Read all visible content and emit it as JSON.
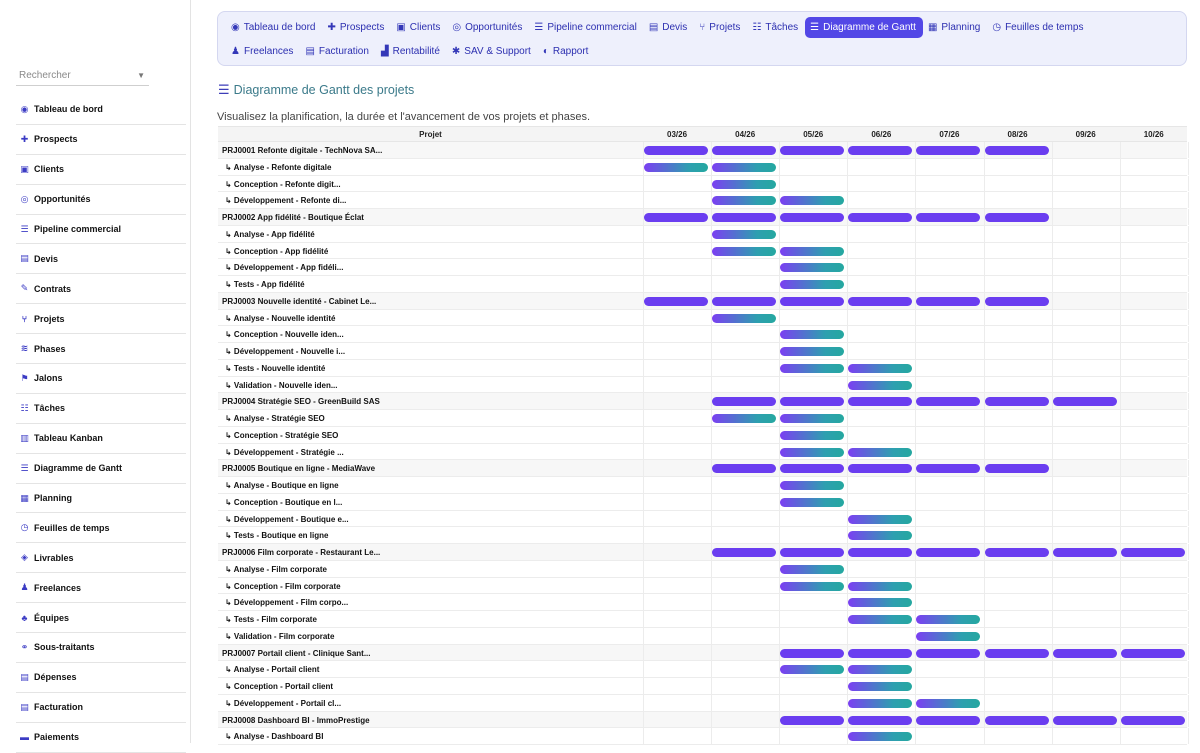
{
  "search": {
    "placeholder": "Rechercher"
  },
  "sidebar": {
    "items": [
      {
        "label": "Tableau de bord",
        "icon": "dashboard-icon",
        "glyph": "◉"
      },
      {
        "label": "Prospects",
        "icon": "user-plus-icon",
        "glyph": "✚"
      },
      {
        "label": "Clients",
        "icon": "id-card-icon",
        "glyph": "▣"
      },
      {
        "label": "Opportunités",
        "icon": "target-icon",
        "glyph": "◎"
      },
      {
        "label": "Pipeline commercial",
        "icon": "pipeline-icon",
        "glyph": "☰"
      },
      {
        "label": "Devis",
        "icon": "file-icon",
        "glyph": "▤"
      },
      {
        "label": "Contrats",
        "icon": "contract-icon",
        "glyph": "✎"
      },
      {
        "label": "Projets",
        "icon": "project-icon",
        "glyph": "⑂"
      },
      {
        "label": "Phases",
        "icon": "layers-icon",
        "glyph": "≋"
      },
      {
        "label": "Jalons",
        "icon": "flag-icon",
        "glyph": "⚑"
      },
      {
        "label": "Tâches",
        "icon": "tasks-icon",
        "glyph": "☷"
      },
      {
        "label": "Tableau Kanban",
        "icon": "kanban-icon",
        "glyph": "▥"
      },
      {
        "label": "Diagramme de Gantt",
        "icon": "gantt-icon",
        "glyph": "☰"
      },
      {
        "label": "Planning",
        "icon": "calendar-icon",
        "glyph": "▦"
      },
      {
        "label": "Feuilles de temps",
        "icon": "clock-icon",
        "glyph": "◷"
      },
      {
        "label": "Livrables",
        "icon": "box-icon",
        "glyph": "◈"
      },
      {
        "label": "Freelances",
        "icon": "user-icon",
        "glyph": "♟"
      },
      {
        "label": "Équipes",
        "icon": "team-icon",
        "glyph": "♣"
      },
      {
        "label": "Sous-traitants",
        "icon": "handshake-icon",
        "glyph": "⚭"
      },
      {
        "label": "Dépenses",
        "icon": "receipt-icon",
        "glyph": "▤"
      },
      {
        "label": "Facturation",
        "icon": "invoice-icon",
        "glyph": "▤"
      },
      {
        "label": "Paiements",
        "icon": "money-icon",
        "glyph": "▬"
      }
    ]
  },
  "topnav": {
    "row1": [
      {
        "label": "Tableau de bord",
        "icon": "dashboard-icon",
        "glyph": "◉",
        "active": false
      },
      {
        "label": "Prospects",
        "icon": "user-plus-icon",
        "glyph": "✚",
        "active": false
      },
      {
        "label": "Clients",
        "icon": "id-card-icon",
        "glyph": "▣",
        "active": false
      },
      {
        "label": "Opportunités",
        "icon": "target-icon",
        "glyph": "◎",
        "active": false
      },
      {
        "label": "Pipeline commercial",
        "icon": "pipeline-icon",
        "glyph": "☰",
        "active": false
      },
      {
        "label": "Devis",
        "icon": "file-icon",
        "glyph": "▤",
        "active": false
      },
      {
        "label": "Projets",
        "icon": "project-icon",
        "glyph": "⑂",
        "active": false
      },
      {
        "label": "Tâches",
        "icon": "tasks-icon",
        "glyph": "☷",
        "active": false
      },
      {
        "label": "Diagramme de Gantt",
        "icon": "gantt-icon",
        "glyph": "☰",
        "active": true
      },
      {
        "label": "Planning",
        "icon": "calendar-icon",
        "glyph": "▦",
        "active": false
      },
      {
        "label": "Feuilles de temps",
        "icon": "clock-icon",
        "glyph": "◷",
        "active": false
      }
    ],
    "row2": [
      {
        "label": "Freelances",
        "icon": "user-icon",
        "glyph": "♟",
        "active": false
      },
      {
        "label": "Facturation",
        "icon": "invoice-icon",
        "glyph": "▤",
        "active": false
      },
      {
        "label": "Rentabilité",
        "icon": "chart-icon",
        "glyph": "▟",
        "active": false
      },
      {
        "label": "SAV & Support",
        "icon": "support-icon",
        "glyph": "✱",
        "active": false
      },
      {
        "label": "Rapport",
        "icon": "report-icon",
        "glyph": "◐",
        "active": false
      }
    ]
  },
  "page": {
    "title": "Diagramme de Gantt des projets",
    "subtitle": "Visualisez la planification, la durée et l'avancement de vos projets et phases."
  },
  "gantt": {
    "project_header": "Projet",
    "months": [
      "03/26",
      "04/26",
      "05/26",
      "06/26",
      "07/26",
      "08/26",
      "09/26",
      "10/26"
    ],
    "rows": [
      {
        "type": "project",
        "label": "PRJ0001 Refonte digitale - TechNova SA...",
        "start": 0,
        "end": 5
      },
      {
        "type": "phase",
        "label": "↳ Analyse - Refonte digitale",
        "start": 0,
        "end": 1
      },
      {
        "type": "phase",
        "label": "↳ Conception - Refonte digit...",
        "start": 1,
        "end": 1
      },
      {
        "type": "phase",
        "label": "↳ Développement - Refonte di...",
        "start": 1,
        "end": 2
      },
      {
        "type": "project",
        "label": "PRJ0002 App fidélité - Boutique Éclat",
        "start": 0,
        "end": 5
      },
      {
        "type": "phase",
        "label": "↳ Analyse - App fidélité",
        "start": 1,
        "end": 1
      },
      {
        "type": "phase",
        "label": "↳ Conception - App fidélité",
        "start": 1,
        "end": 2
      },
      {
        "type": "phase",
        "label": "↳ Développement - App fidéli...",
        "start": 2,
        "end": 2
      },
      {
        "type": "phase",
        "label": "↳ Tests - App fidélité",
        "start": 2,
        "end": 2
      },
      {
        "type": "project",
        "label": "PRJ0003 Nouvelle identité - Cabinet Le...",
        "start": 0,
        "end": 5
      },
      {
        "type": "phase",
        "label": "↳ Analyse - Nouvelle identité",
        "start": 1,
        "end": 1
      },
      {
        "type": "phase",
        "label": "↳ Conception - Nouvelle iden...",
        "start": 2,
        "end": 2
      },
      {
        "type": "phase",
        "label": "↳ Développement - Nouvelle i...",
        "start": 2,
        "end": 2
      },
      {
        "type": "phase",
        "label": "↳ Tests - Nouvelle identité",
        "start": 2,
        "end": 3
      },
      {
        "type": "phase",
        "label": "↳ Validation - Nouvelle iden...",
        "start": 3,
        "end": 3
      },
      {
        "type": "project",
        "label": "PRJ0004 Stratégie SEO - GreenBuild SAS",
        "start": 1,
        "end": 6
      },
      {
        "type": "phase",
        "label": "↳ Analyse - Stratégie SEO",
        "start": 1,
        "end": 2
      },
      {
        "type": "phase",
        "label": "↳ Conception - Stratégie SEO",
        "start": 2,
        "end": 2
      },
      {
        "type": "phase",
        "label": "↳ Développement - Stratégie ...",
        "start": 2,
        "end": 3
      },
      {
        "type": "project",
        "label": "PRJ0005 Boutique en ligne - MediaWave",
        "start": 1,
        "end": 5
      },
      {
        "type": "phase",
        "label": "↳ Analyse - Boutique en ligne",
        "start": 2,
        "end": 2
      },
      {
        "type": "phase",
        "label": "↳ Conception - Boutique en l...",
        "start": 2,
        "end": 2
      },
      {
        "type": "phase",
        "label": "↳ Développement - Boutique e...",
        "start": 3,
        "end": 3
      },
      {
        "type": "phase",
        "label": "↳ Tests - Boutique en ligne",
        "start": 3,
        "end": 3
      },
      {
        "type": "project",
        "label": "PRJ0006 Film corporate - Restaurant Le...",
        "start": 1,
        "end": 7
      },
      {
        "type": "phase",
        "label": "↳ Analyse - Film corporate",
        "start": 2,
        "end": 2
      },
      {
        "type": "phase",
        "label": "↳ Conception - Film corporate",
        "start": 2,
        "end": 3
      },
      {
        "type": "phase",
        "label": "↳ Développement - Film corpo...",
        "start": 3,
        "end": 3
      },
      {
        "type": "phase",
        "label": "↳ Tests - Film corporate",
        "start": 3,
        "end": 4
      },
      {
        "type": "phase",
        "label": "↳ Validation - Film corporate",
        "start": 4,
        "end": 4
      },
      {
        "type": "project",
        "label": "PRJ0007 Portail client - Clinique Sant...",
        "start": 2,
        "end": 7
      },
      {
        "type": "phase",
        "label": "↳ Analyse - Portail client",
        "start": 2,
        "end": 3
      },
      {
        "type": "phase",
        "label": "↳ Conception - Portail client",
        "start": 3,
        "end": 3
      },
      {
        "type": "phase",
        "label": "↳ Développement - Portail cl...",
        "start": 3,
        "end": 4
      },
      {
        "type": "project",
        "label": "PRJ0008 Dashboard BI - ImmoPrestige",
        "start": 2,
        "end": 7
      },
      {
        "type": "phase",
        "label": "↳ Analyse - Dashboard BI",
        "start": 3,
        "end": 3
      }
    ]
  },
  "colors": {
    "accent": "#5247e6",
    "project_bar": "#6a3df0",
    "phase_bar_start": "#7b3ff2",
    "phase_bar_end": "#25a8a0"
  }
}
